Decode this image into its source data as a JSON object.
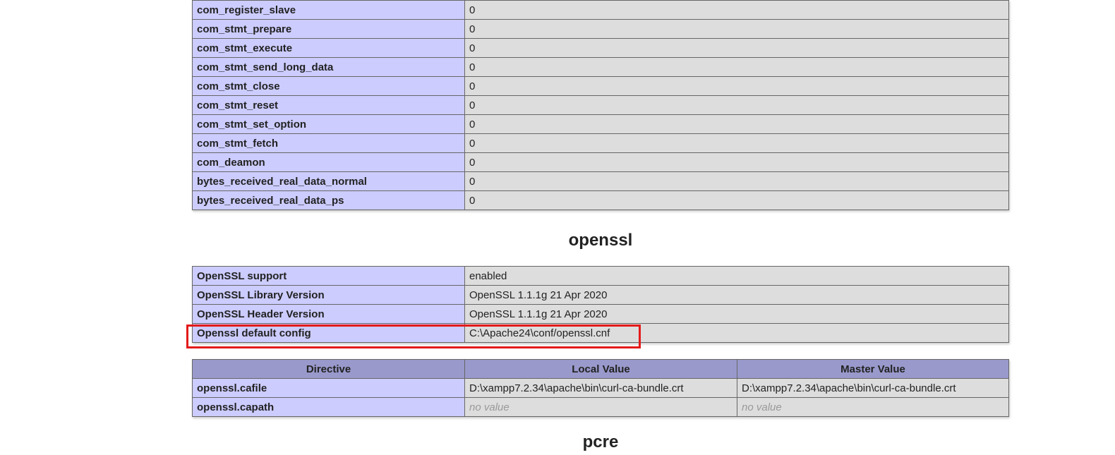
{
  "stats_table": {
    "rows": [
      {
        "name": "com_register_slave",
        "value": "0"
      },
      {
        "name": "com_stmt_prepare",
        "value": "0"
      },
      {
        "name": "com_stmt_execute",
        "value": "0"
      },
      {
        "name": "com_stmt_send_long_data",
        "value": "0"
      },
      {
        "name": "com_stmt_close",
        "value": "0"
      },
      {
        "name": "com_stmt_reset",
        "value": "0"
      },
      {
        "name": "com_stmt_set_option",
        "value": "0"
      },
      {
        "name": "com_stmt_fetch",
        "value": "0"
      },
      {
        "name": "com_deamon",
        "value": "0"
      },
      {
        "name": "bytes_received_real_data_normal",
        "value": "0"
      },
      {
        "name": "bytes_received_real_data_ps",
        "value": "0"
      }
    ]
  },
  "openssl": {
    "title": "openssl",
    "info_rows": [
      {
        "name": "OpenSSL support",
        "value": "enabled"
      },
      {
        "name": "OpenSSL Library Version",
        "value": "OpenSSL 1.1.1g 21 Apr 2020"
      },
      {
        "name": "OpenSSL Header Version",
        "value": "OpenSSL 1.1.1g 21 Apr 2020"
      },
      {
        "name": "Openssl default config",
        "value": "C:\\Apache24\\conf/openssl.cnf"
      }
    ],
    "directives": {
      "headers": {
        "directive": "Directive",
        "local": "Local Value",
        "master": "Master Value"
      },
      "rows": [
        {
          "name": "openssl.cafile",
          "local": "D:\\xampp7.2.34\\apache\\bin\\curl-ca-bundle.crt",
          "master": "D:\\xampp7.2.34\\apache\\bin\\curl-ca-bundle.crt"
        },
        {
          "name": "openssl.capath",
          "local": "no value",
          "master": "no value"
        }
      ]
    }
  },
  "pcre": {
    "title": "pcre"
  },
  "highlight_color": "#e41a1a"
}
